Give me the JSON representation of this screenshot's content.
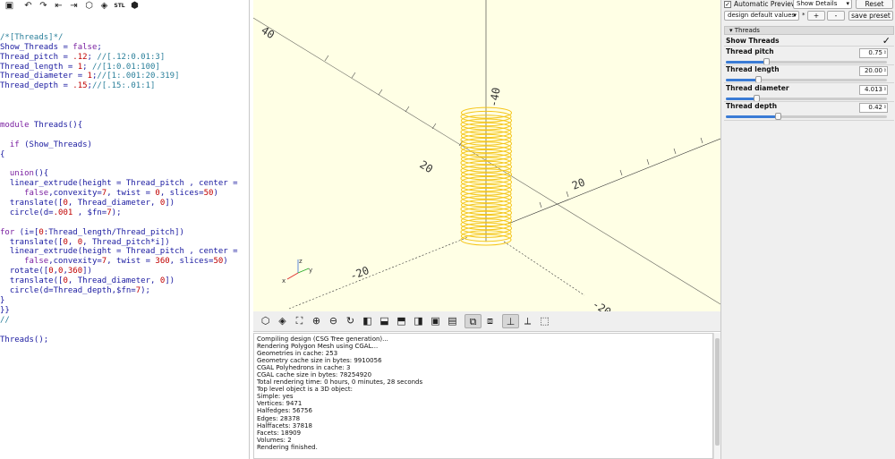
{
  "editor": {
    "toolbar_icons": [
      "save-icon",
      "undo-icon",
      "redo-icon",
      "unindent-icon",
      "indent-icon",
      "preview-icon",
      "render-icon",
      "export-stl-icon",
      "export-3d-icon"
    ],
    "export_stl_label": "STL",
    "lines": [
      [
        {
          "t": "",
          "c": "b"
        }
      ],
      [
        {
          "t": "/*[Threads]*/",
          "c": "cm"
        }
      ],
      [
        {
          "t": "Show_Threads",
          "c": "b"
        },
        {
          "t": " = ",
          "c": "b"
        },
        {
          "t": "false",
          "c": "k"
        },
        {
          "t": ";",
          "c": "b"
        }
      ],
      [
        {
          "t": "Thread_pitch = ",
          "c": "b"
        },
        {
          "t": ".12",
          "c": "n"
        },
        {
          "t": "; ",
          "c": "b"
        },
        {
          "t": "//[.12:0.01:3]",
          "c": "cm"
        }
      ],
      [
        {
          "t": "Thread_length = ",
          "c": "b"
        },
        {
          "t": "1",
          "c": "n"
        },
        {
          "t": "; ",
          "c": "b"
        },
        {
          "t": "//[1:0.01:100]",
          "c": "cm"
        }
      ],
      [
        {
          "t": "Thread_diameter = ",
          "c": "b"
        },
        {
          "t": "1",
          "c": "n"
        },
        {
          "t": ";",
          "c": "b"
        },
        {
          "t": "//[1:.001:20.319]",
          "c": "cm"
        }
      ],
      [
        {
          "t": "Thread_depth = ",
          "c": "b"
        },
        {
          "t": ".15",
          "c": "n"
        },
        {
          "t": ";",
          "c": "b"
        },
        {
          "t": "//[.15:.01:1]",
          "c": "cm"
        }
      ],
      [
        {
          "t": "",
          "c": "b"
        }
      ],
      [
        {
          "t": "",
          "c": "b"
        }
      ],
      [
        {
          "t": "",
          "c": "b"
        }
      ],
      [
        {
          "t": "module",
          "c": "k"
        },
        {
          "t": " Threads(){",
          "c": "b"
        }
      ],
      [
        {
          "t": "",
          "c": "b"
        }
      ],
      [
        {
          "t": "  if",
          "c": "k"
        },
        {
          "t": " (Show_Threads)",
          "c": "b"
        }
      ],
      [
        {
          "t": "{",
          "c": "b"
        }
      ],
      [
        {
          "t": "",
          "c": "b"
        }
      ],
      [
        {
          "t": "  union",
          "c": "k"
        },
        {
          "t": "(){",
          "c": "b"
        }
      ],
      [
        {
          "t": "  linear_extrude(height = Thread_pitch , center =",
          "c": "b"
        }
      ],
      [
        {
          "t": "     false",
          "c": "k"
        },
        {
          "t": ",convexity=",
          "c": "b"
        },
        {
          "t": "7",
          "c": "n"
        },
        {
          "t": ", twist = ",
          "c": "b"
        },
        {
          "t": "0",
          "c": "n"
        },
        {
          "t": ", slices=",
          "c": "b"
        },
        {
          "t": "50",
          "c": "n"
        },
        {
          "t": ")",
          "c": "b"
        }
      ],
      [
        {
          "t": "  translate([",
          "c": "b"
        },
        {
          "t": "0",
          "c": "n"
        },
        {
          "t": ", Thread_diameter, ",
          "c": "b"
        },
        {
          "t": "0",
          "c": "n"
        },
        {
          "t": "])",
          "c": "b"
        }
      ],
      [
        {
          "t": "  circle(d=",
          "c": "b"
        },
        {
          "t": ".001",
          "c": "n"
        },
        {
          "t": " , $fn=",
          "c": "b"
        },
        {
          "t": "7",
          "c": "n"
        },
        {
          "t": ");",
          "c": "b"
        }
      ],
      [
        {
          "t": "",
          "c": "b"
        }
      ],
      [
        {
          "t": "for",
          "c": "k"
        },
        {
          "t": " (i=[",
          "c": "b"
        },
        {
          "t": "0",
          "c": "n"
        },
        {
          "t": ":Thread_length/Thread_pitch])",
          "c": "b"
        }
      ],
      [
        {
          "t": "  translate([",
          "c": "b"
        },
        {
          "t": "0",
          "c": "n"
        },
        {
          "t": ", ",
          "c": "b"
        },
        {
          "t": "0",
          "c": "n"
        },
        {
          "t": ", Thread_pitch*i])",
          "c": "b"
        }
      ],
      [
        {
          "t": "  linear_extrude(height = Thread_pitch , center =",
          "c": "b"
        }
      ],
      [
        {
          "t": "     false",
          "c": "k"
        },
        {
          "t": ",convexity=",
          "c": "b"
        },
        {
          "t": "7",
          "c": "n"
        },
        {
          "t": ", twist = ",
          "c": "b"
        },
        {
          "t": "360",
          "c": "n"
        },
        {
          "t": ", slices=",
          "c": "b"
        },
        {
          "t": "50",
          "c": "n"
        },
        {
          "t": ")",
          "c": "b"
        }
      ],
      [
        {
          "t": "  rotate([",
          "c": "b"
        },
        {
          "t": "0",
          "c": "n"
        },
        {
          "t": ",",
          "c": "b"
        },
        {
          "t": "0",
          "c": "n"
        },
        {
          "t": ",",
          "c": "b"
        },
        {
          "t": "360",
          "c": "n"
        },
        {
          "t": "])",
          "c": "b"
        }
      ],
      [
        {
          "t": "  translate([",
          "c": "b"
        },
        {
          "t": "0",
          "c": "n"
        },
        {
          "t": ", Thread_diameter, ",
          "c": "b"
        },
        {
          "t": "0",
          "c": "n"
        },
        {
          "t": "])",
          "c": "b"
        }
      ],
      [
        {
          "t": "  circle(d=Thread_depth,$fn=",
          "c": "b"
        },
        {
          "t": "7",
          "c": "n"
        },
        {
          "t": ");",
          "c": "b"
        }
      ],
      [
        {
          "t": "}",
          "c": "b"
        }
      ],
      [
        {
          "t": "}}",
          "c": "b"
        }
      ],
      [
        {
          "t": "//",
          "c": "cm"
        }
      ],
      [
        {
          "t": "",
          "c": "b"
        }
      ],
      [
        {
          "t": "Threads();",
          "c": "b"
        }
      ]
    ]
  },
  "viewport": {
    "axis_labels": [
      "40",
      "20",
      "20",
      "-20",
      "-20",
      "-40"
    ],
    "model_color": "#f5c518"
  },
  "view_toolbar": {
    "icons": [
      "preview-icon",
      "render-icon",
      "zoom-all-icon",
      "zoom-in-icon",
      "zoom-out-icon",
      "reset-view-icon",
      "view-right-icon",
      "view-top-icon",
      "view-bottom-icon",
      "view-left-icon",
      "view-front-icon",
      "view-back-icon",
      "perspective-icon",
      "orthogonal-icon",
      "show-axes-icon",
      "show-scale-icon",
      "show-edges-icon"
    ]
  },
  "console": {
    "lines": [
      "Compiling design (CSG Tree generation)...",
      "Rendering Polygon Mesh using CGAL...",
      "Geometries in cache: 253",
      "Geometry cache size in bytes: 9910056",
      "CGAL Polyhedrons in cache: 3",
      "CGAL cache size in bytes: 78254920",
      "Total rendering time: 0 hours, 0 minutes, 28 seconds",
      "Top level object is a 3D object:",
      "Simple: yes",
      "Vertices: 9471",
      "Halfedges: 56756",
      "Edges: 28378",
      "Halffacets: 37818",
      "Facets: 18909",
      "Volumes: 2",
      "Rendering finished."
    ]
  },
  "customizer": {
    "auto_preview_label": "Automatic Preview",
    "auto_preview_checked": "✓",
    "details_select": "Show Details",
    "reset_label": "Reset",
    "preset_select": "design default values",
    "star": "*",
    "plus_label": "+",
    "minus_label": "-",
    "save_preset_label": "save preset",
    "group_label": "Threads",
    "group_arrow": "▾",
    "show_threads_label": "Show Threads",
    "show_threads_check": "✓",
    "params": [
      {
        "label": "Thread pitch",
        "value": "0.75",
        "fraction": 0.25
      },
      {
        "label": "Thread length",
        "value": "20.00",
        "fraction": 0.2
      },
      {
        "label": "Thread diameter",
        "value": "4.013",
        "fraction": 0.19
      },
      {
        "label": "Thread depth",
        "value": "0.42",
        "fraction": 0.32
      }
    ]
  }
}
